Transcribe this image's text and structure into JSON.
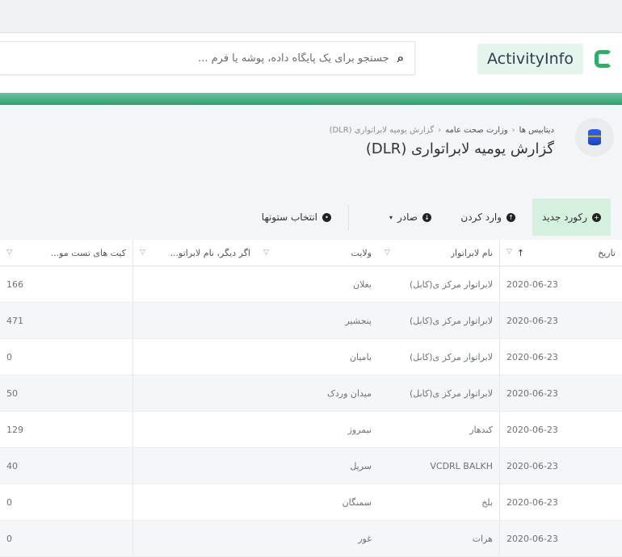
{
  "app": {
    "name": "ActivityInfo",
    "search_placeholder": "جستجو برای یک پایگاه داده، پوشه یا فرم ..."
  },
  "breadcrumb": {
    "items": [
      "دیتابیس ها",
      "وزارت صحت عامه",
      "گزارش یومیه لابراتواری (DLR)"
    ]
  },
  "page": {
    "title": "گزارش یومیه لابراتواری (DLR)"
  },
  "toolbar": {
    "new_record": "رکورد جدید",
    "import": "وارد کردن",
    "export": "صادر",
    "choose_columns": "انتخاب ستونها"
  },
  "table": {
    "headers": {
      "date": "تاریخ",
      "lab_name": "نام لابراتوار",
      "province": "ولایت",
      "other_lab": "اگر دیگر، نام لابراتو...",
      "test_kits": "کیت های تست مو..."
    },
    "rows": [
      {
        "date": "2020-06-23",
        "lab_name": "لابراتوار مرکز ی(کابل)",
        "province": "بغلان",
        "other_lab": "",
        "test_kits": "166"
      },
      {
        "date": "2020-06-23",
        "lab_name": "لابراتوار مرکز ی(کابل)",
        "province": "پنجشیر",
        "other_lab": "",
        "test_kits": "471"
      },
      {
        "date": "2020-06-23",
        "lab_name": "لابراتوار مرکز ی(کابل)",
        "province": "بامیان",
        "other_lab": "",
        "test_kits": "0"
      },
      {
        "date": "2020-06-23",
        "lab_name": "لابراتوار مرکز ی(کابل)",
        "province": "میدان وردک",
        "other_lab": "",
        "test_kits": "50"
      },
      {
        "date": "2020-06-23",
        "lab_name": "کندهار",
        "province": "نیمروز",
        "other_lab": "",
        "test_kits": "129"
      },
      {
        "date": "2020-06-23",
        "lab_name": "VCDRL BALKH",
        "province": "سرپل",
        "other_lab": "",
        "test_kits": "40"
      },
      {
        "date": "2020-06-23",
        "lab_name": "بلخ",
        "province": "سمنگان",
        "other_lab": "",
        "test_kits": "0"
      },
      {
        "date": "2020-06-23",
        "lab_name": "هرات",
        "province": "غور",
        "other_lab": "",
        "test_kits": "0"
      }
    ]
  },
  "colors": {
    "accent_green": "#2f9e6e",
    "new_button_bg": "#d4f0de",
    "db_icon_blue": "#2d5be3"
  }
}
